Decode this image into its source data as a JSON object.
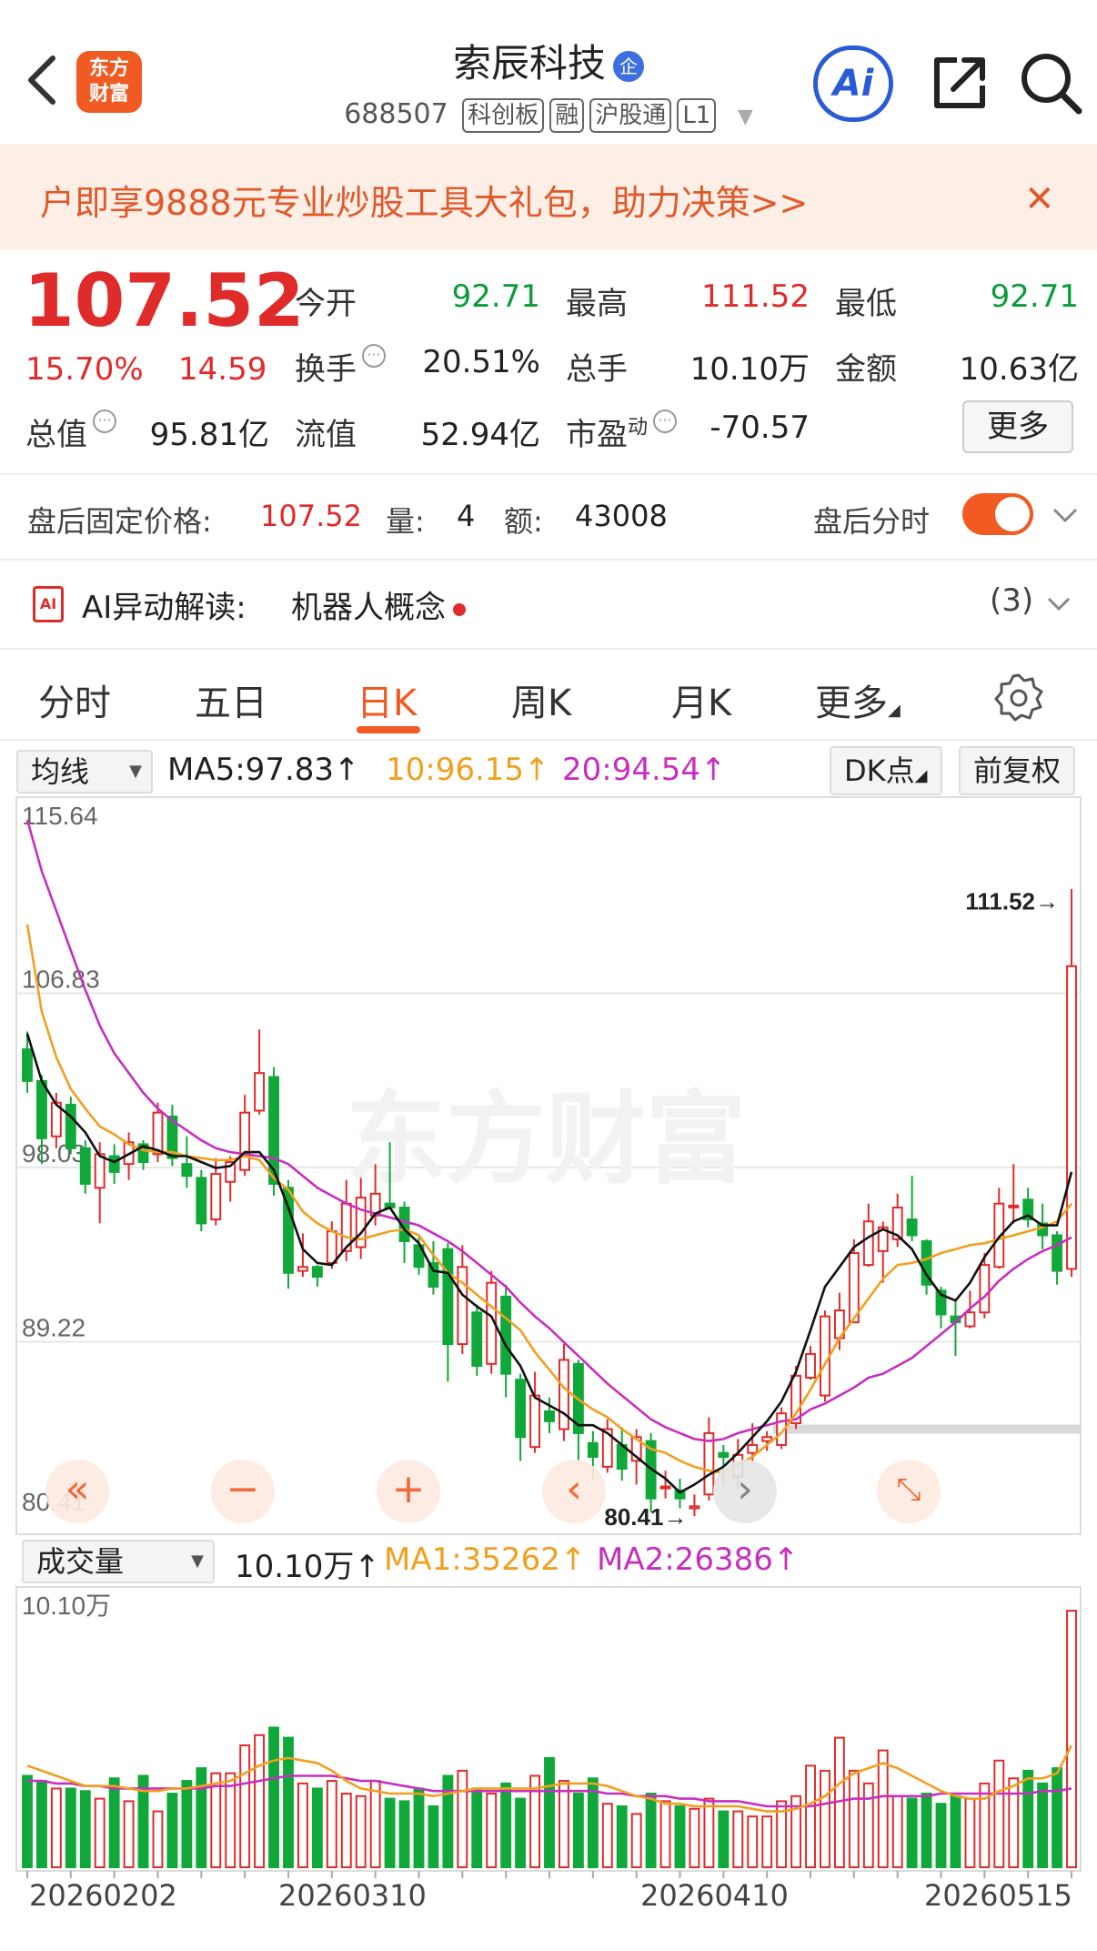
{
  "header": {
    "logo_text": "东方财富",
    "title": "索辰科技",
    "title_badge": "企",
    "code": "688507",
    "tags": [
      "科创板",
      "融",
      "沪股通",
      "L1"
    ],
    "ai_label": "Ai"
  },
  "banner": {
    "text": "户即享9888元专业炒股工具大礼包，助力决策>>"
  },
  "quote": {
    "price": "107.52",
    "change_pct": "15.70%",
    "change_amt": "14.59",
    "open_label": "今开",
    "open": "92.71",
    "high_label": "最高",
    "high": "111.52",
    "low_label": "最低",
    "low": "92.71",
    "turnover_label": "换手",
    "turnover": "20.51%",
    "volume_label": "总手",
    "volume": "10.10万",
    "amount_label": "金额",
    "amount": "10.63亿",
    "mktcap_label": "总值",
    "mktcap": "95.81亿",
    "float_label": "流值",
    "float_cap": "52.94亿",
    "pe_label": "市盈",
    "pe_sup": "动",
    "pe": "-70.57",
    "more_label": "更多"
  },
  "after_hours": {
    "label": "盘后固定价格:",
    "price": "107.52",
    "qty_label": "量:",
    "qty": "4",
    "amt_label": "额:",
    "amt": "43008",
    "toggle_label": "盘后分时"
  },
  "ai_alert": {
    "label": "AI异动解读:",
    "value": "机器人概念",
    "count": "(3)"
  },
  "tabs": [
    "分时",
    "五日",
    "日K",
    "周K",
    "月K",
    "更多"
  ],
  "active_tab": 2,
  "indicators": {
    "ma_select": "均线",
    "ma5": "MA5:97.83↑",
    "ma10": "10:96.15↑",
    "ma20": "20:94.54↑",
    "dk_label": "DK点",
    "adjust_label": "前复权"
  },
  "volume_panel": {
    "select": "成交量",
    "vol": "10.10万↑",
    "ma1": "MA1:35262↑",
    "ma2": "MA2:26386↑",
    "max_label": "10.10万"
  },
  "chart_data": {
    "type": "candlestick",
    "y_ticks": [
      "115.64",
      "106.83",
      "98.03",
      "89.22",
      "80.41"
    ],
    "ylim": [
      80.41,
      115.64
    ],
    "high_annotation": "111.52",
    "low_annotation": "80.41",
    "x_labels": [
      "20260202",
      "20260310",
      "20260410",
      "20260515"
    ],
    "watermark": "东方财富",
    "colors": {
      "up": "#e02b2b",
      "down": "#11a83a",
      "ma5": "#111111",
      "ma10": "#f0a020",
      "ma20": "#c72fbf"
    },
    "candles": [
      [
        104.0,
        104.9,
        101.8,
        102.4
      ],
      [
        102.4,
        102.7,
        98.2,
        99.5
      ],
      [
        99.6,
        101.8,
        99.0,
        101.3
      ],
      [
        101.2,
        101.6,
        98.7,
        99.0
      ],
      [
        99.0,
        99.4,
        96.7,
        97.2
      ],
      [
        97.0,
        99.3,
        95.2,
        98.7
      ],
      [
        98.6,
        99.2,
        97.2,
        97.8
      ],
      [
        98.2,
        99.8,
        97.4,
        99.3
      ],
      [
        99.2,
        99.4,
        97.9,
        98.3
      ],
      [
        98.7,
        101.3,
        98.3,
        100.8
      ],
      [
        100.6,
        101.2,
        98.1,
        98.5
      ],
      [
        98.2,
        99.6,
        97.0,
        97.6
      ],
      [
        97.5,
        97.9,
        94.8,
        95.2
      ],
      [
        95.4,
        98.5,
        95.1,
        97.7
      ],
      [
        97.3,
        98.6,
        96.3,
        98.3
      ],
      [
        97.9,
        101.7,
        97.6,
        100.8
      ],
      [
        100.9,
        105.0,
        100.7,
        102.8
      ],
      [
        102.6,
        103.1,
        96.6,
        97.2
      ],
      [
        97.0,
        97.4,
        91.9,
        92.7
      ],
      [
        92.8,
        94.7,
        92.5,
        93.0
      ],
      [
        93.0,
        93.1,
        92.0,
        92.5
      ],
      [
        93.2,
        95.3,
        92.9,
        94.8
      ],
      [
        93.8,
        97.4,
        93.3,
        96.2
      ],
      [
        94.0,
        97.5,
        93.4,
        96.5
      ],
      [
        95.6,
        98.2,
        95.1,
        96.7
      ],
      [
        96.2,
        99.3,
        95.9,
        96.0
      ],
      [
        96.0,
        96.3,
        93.2,
        94.3
      ],
      [
        94.1,
        94.5,
        92.6,
        93.0
      ],
      [
        93.2,
        94.3,
        91.6,
        92.0
      ],
      [
        93.9,
        94.2,
        87.2,
        89.1
      ],
      [
        89.1,
        94.1,
        88.6,
        93.0
      ],
      [
        90.7,
        91.1,
        87.5,
        88.0
      ],
      [
        88.1,
        92.8,
        87.6,
        92.2
      ],
      [
        91.5,
        92.1,
        86.4,
        87.6
      ],
      [
        87.3,
        87.6,
        83.2,
        84.4
      ],
      [
        83.9,
        87.7,
        83.6,
        86.5
      ],
      [
        85.7,
        86.4,
        84.6,
        85.2
      ],
      [
        84.8,
        89.1,
        84.2,
        88.3
      ],
      [
        88.1,
        88.3,
        83.2,
        84.6
      ],
      [
        84.1,
        84.7,
        82.2,
        83.4
      ],
      [
        82.9,
        85.3,
        82.6,
        84.8
      ],
      [
        84.0,
        84.9,
        82.2,
        82.8
      ],
      [
        83.2,
        84.8,
        82.0,
        84.4
      ],
      [
        84.2,
        84.6,
        80.6,
        81.3
      ],
      [
        81.9,
        82.7,
        81.3,
        81.9
      ],
      [
        81.7,
        82.3,
        80.8,
        81.3
      ],
      [
        80.8,
        81.5,
        80.4,
        80.9
      ],
      [
        81.5,
        85.4,
        81.2,
        84.6
      ],
      [
        83.6,
        84.0,
        81.9,
        83.4
      ],
      [
        82.4,
        84.3,
        81.8,
        83.5
      ],
      [
        83.6,
        85.1,
        83.0,
        84.0
      ],
      [
        84.2,
        84.7,
        83.7,
        84.4
      ],
      [
        84.0,
        85.9,
        83.8,
        85.6
      ],
      [
        85.1,
        88.0,
        84.8,
        87.5
      ],
      [
        87.4,
        89.0,
        87.3,
        88.6
      ],
      [
        86.5,
        90.8,
        86.2,
        90.5
      ],
      [
        89.4,
        91.7,
        88.8,
        90.8
      ],
      [
        90.2,
        94.4,
        90.2,
        93.7
      ],
      [
        93.1,
        96.2,
        93.0,
        95.3
      ],
      [
        93.8,
        95.3,
        92.2,
        95.0
      ],
      [
        94.4,
        96.7,
        94.0,
        96.0
      ],
      [
        95.4,
        97.6,
        94.3,
        94.6
      ],
      [
        94.3,
        94.4,
        91.6,
        92.1
      ],
      [
        91.8,
        92.0,
        89.9,
        90.6
      ],
      [
        90.5,
        91.3,
        88.5,
        90.2
      ],
      [
        90.0,
        91.8,
        89.9,
        90.7
      ],
      [
        90.7,
        93.7,
        90.4,
        93.1
      ],
      [
        93.0,
        97.0,
        92.9,
        96.2
      ],
      [
        96.1,
        98.2,
        95.2,
        96.1
      ],
      [
        96.4,
        97.0,
        95.0,
        95.4
      ],
      [
        95.2,
        96.2,
        93.9,
        94.6
      ],
      [
        94.6,
        94.8,
        92.1,
        92.8
      ],
      [
        92.9,
        112.1,
        92.5,
        108.2
      ]
    ],
    "ma5": [
      104.8,
      102.4,
      101.2,
      100.6,
      99.8,
      98.6,
      98.3,
      98.7,
      99.1,
      98.9,
      98.6,
      98.6,
      98.3,
      98.0,
      98.1,
      98.8,
      98.8,
      97.9,
      96.0,
      93.9,
      93.2,
      93.1,
      94.0,
      94.7,
      95.7,
      96.0,
      94.9,
      94.2,
      92.8,
      92.7,
      91.6,
      91.0,
      90.5,
      89.0,
      88.0,
      86.4,
      86.0,
      85.6,
      85.0,
      85.0,
      84.6,
      84.0,
      83.4,
      82.8,
      82.3,
      81.6,
      82.0,
      82.5,
      82.9,
      83.6,
      84.4,
      85.2,
      86.2,
      87.7,
      89.8,
      92.0,
      93.0,
      94.0,
      94.5,
      94.9,
      94.6,
      93.9,
      92.6,
      91.6,
      91.3,
      92.2,
      93.5,
      94.5,
      95.3,
      95.6,
      95.1,
      95.1,
      97.8
    ],
    "ma10": [
      110.3,
      105.9,
      103.6,
      102.0,
      101.0,
      100.1,
      99.7,
      99.2,
      98.9,
      98.8,
      98.8,
      98.6,
      98.5,
      98.4,
      98.4,
      98.6,
      98.4,
      97.5,
      96.9,
      95.8,
      95.2,
      94.8,
      94.5,
      94.4,
      94.6,
      94.8,
      94.9,
      94.6,
      93.6,
      92.7,
      92.2,
      91.6,
      91.0,
      90.4,
      89.8,
      88.7,
      87.8,
      86.9,
      86.3,
      85.8,
      85.4,
      84.8,
      84.3,
      83.8,
      83.6,
      83.2,
      82.9,
      82.7,
      82.6,
      83.0,
      83.4,
      84.0,
      84.6,
      85.6,
      86.8,
      88.1,
      89.4,
      90.4,
      91.4,
      92.4,
      93.1,
      93.2,
      93.4,
      93.7,
      93.9,
      94.1,
      94.2,
      94.4,
      94.6,
      94.8,
      95.0,
      95.3,
      96.2
    ],
    "ma20": [
      115.6,
      113.0,
      111.0,
      109.0,
      107.0,
      105.2,
      103.8,
      102.8,
      101.8,
      101.0,
      100.4,
      99.9,
      99.4,
      99.0,
      98.8,
      98.7,
      98.6,
      98.5,
      98.2,
      97.6,
      97.0,
      96.6,
      96.2,
      95.9,
      95.7,
      95.5,
      95.3,
      95.1,
      94.7,
      94.3,
      93.8,
      93.2,
      92.6,
      92.0,
      91.2,
      90.5,
      89.9,
      89.2,
      88.5,
      87.8,
      87.1,
      86.5,
      85.9,
      85.3,
      84.9,
      84.6,
      84.3,
      84.2,
      84.3,
      84.6,
      84.8,
      85.0,
      85.2,
      85.3,
      85.8,
      86.1,
      86.5,
      86.9,
      87.4,
      87.6,
      88.0,
      88.4,
      89.0,
      89.6,
      90.2,
      90.9,
      91.5,
      92.3,
      92.9,
      93.4,
      93.8,
      94.1,
      94.5
    ],
    "volume_max": 101000,
    "volume": [
      36000,
      34000,
      31000,
      31000,
      30000,
      27000,
      35000,
      26000,
      36000,
      22000,
      29000,
      34000,
      39000,
      37000,
      37000,
      48000,
      52000,
      55000,
      51000,
      33000,
      31000,
      34000,
      29000,
      28000,
      34000,
      27000,
      26000,
      31000,
      24000,
      36000,
      38000,
      31000,
      29000,
      33000,
      27000,
      36000,
      43000,
      34000,
      29000,
      35000,
      25000,
      24000,
      21000,
      29000,
      26000,
      24000,
      23000,
      27000,
      22000,
      22000,
      20000,
      20000,
      26000,
      28000,
      40000,
      38000,
      51000,
      38000,
      33000,
      46000,
      28000,
      27000,
      29000,
      25000,
      28000,
      27000,
      33000,
      42000,
      35000,
      38000,
      33000,
      39000,
      101000
    ],
    "vol_ma1": [
      40000,
      38000,
      36000,
      34000,
      32000,
      32000,
      32000,
      31000,
      30000,
      30000,
      31000,
      31000,
      32000,
      33000,
      34000,
      37000,
      40000,
      42000,
      43000,
      42000,
      41000,
      38000,
      34000,
      31000,
      30000,
      29000,
      29000,
      29000,
      28000,
      29000,
      30000,
      31000,
      31000,
      31000,
      31000,
      31000,
      32000,
      33000,
      33000,
      33000,
      32000,
      30000,
      28000,
      27000,
      25000,
      25000,
      24000,
      24000,
      24000,
      24000,
      23000,
      22000,
      22000,
      23000,
      25000,
      28000,
      33000,
      37000,
      39000,
      41000,
      39000,
      36000,
      33000,
      30000,
      28000,
      27000,
      27000,
      30000,
      32000,
      35000,
      35000,
      37000,
      48000
    ],
    "vol_ma2": [
      34000,
      34000,
      33000,
      33000,
      32000,
      32000,
      31000,
      31000,
      31000,
      31000,
      31000,
      31000,
      31000,
      32000,
      32000,
      33000,
      34000,
      35000,
      36000,
      36000,
      36000,
      36000,
      35000,
      34000,
      34000,
      33000,
      32000,
      31000,
      30000,
      30000,
      30000,
      30000,
      30000,
      30000,
      30000,
      30000,
      30000,
      30000,
      30000,
      30000,
      29000,
      29000,
      28000,
      28000,
      28000,
      27000,
      27000,
      26000,
      26000,
      26000,
      25000,
      24000,
      24000,
      24000,
      24000,
      25000,
      26000,
      27000,
      27000,
      28000,
      28000,
      28000,
      28000,
      29000,
      29000,
      29000,
      29000,
      29000,
      29000,
      29000,
      30000,
      30000,
      31000
    ]
  }
}
